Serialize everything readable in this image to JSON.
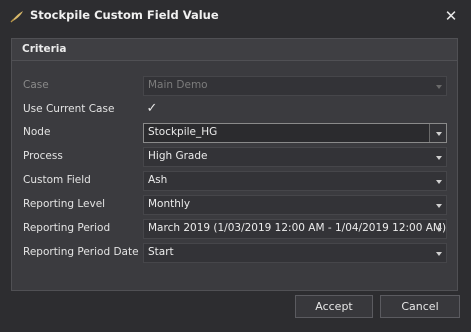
{
  "window": {
    "title": "Stockpile Custom Field Value",
    "close_glyph": "✕",
    "app_icon": "feather-icon"
  },
  "criteria": {
    "header": "Criteria",
    "case": {
      "label": "Case",
      "value": "Main Demo",
      "enabled": false
    },
    "use_current_case": {
      "label": "Use Current Case",
      "checked": true,
      "glyph": "✓"
    },
    "node": {
      "label": "Node",
      "value": "Stockpile_HG"
    },
    "process": {
      "label": "Process",
      "value": "High Grade"
    },
    "custom_field": {
      "label": "Custom Field",
      "value": "Ash"
    },
    "reporting_level": {
      "label": "Reporting Level",
      "value": "Monthly"
    },
    "reporting_period": {
      "label": "Reporting Period",
      "value": "March 2019 (1/03/2019 12:00 AM - 1/04/2019 12:00 AM)"
    },
    "reporting_period_date": {
      "label": "Reporting Period Date",
      "value": "Start"
    }
  },
  "footer": {
    "accept_label": "Accept",
    "cancel_label": "Cancel"
  },
  "colors": {
    "background": "#2d2d30",
    "panel": "#3b3b3f",
    "accent_icon": "#d9b96a"
  }
}
